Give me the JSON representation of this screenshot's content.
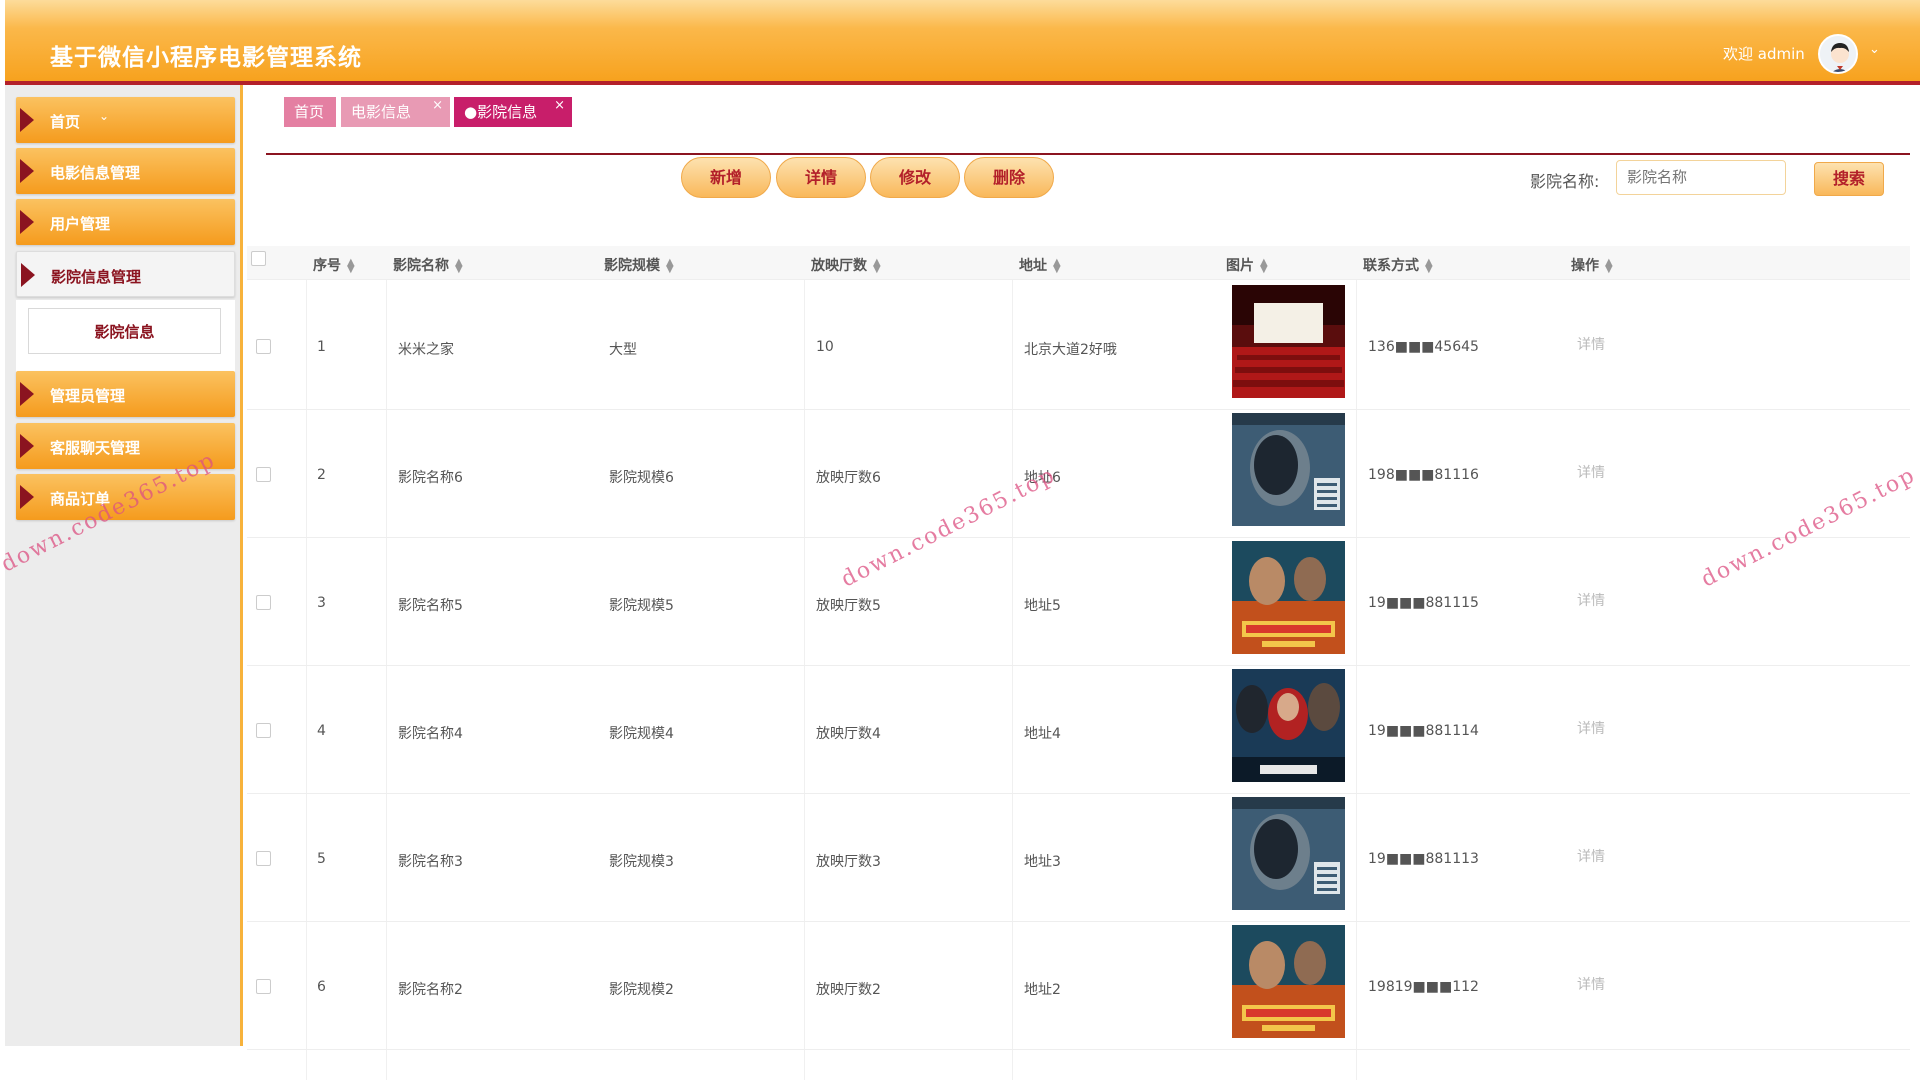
{
  "header": {
    "title": "基于微信小程序电影管理系统",
    "welcome": "欢迎 admin",
    "chevron": "⌄"
  },
  "sidebar": {
    "items": [
      {
        "label": "首页"
      },
      {
        "label": "电影信息管理"
      },
      {
        "label": "用户管理"
      },
      {
        "label": "影院信息管理"
      },
      {
        "label": "管理员管理"
      },
      {
        "label": "客服聊天管理"
      },
      {
        "label": "商品订单"
      }
    ],
    "home_chevron": "⌄",
    "submenu_label": "影院信息"
  },
  "tabs": [
    {
      "label": "首页"
    },
    {
      "label": "电影信息",
      "close": "×"
    },
    {
      "label": "●影院信息",
      "close": "×"
    }
  ],
  "toolbar": {
    "add": "新增",
    "detail": "详情",
    "edit": "修改",
    "delete": "删除",
    "search_label": "影院名称:",
    "search_placeholder": "影院名称",
    "search_button": "搜索"
  },
  "table": {
    "columns": [
      "序号",
      "影院名称",
      "影院规模",
      "放映厅数",
      "地址",
      "图片",
      "联系方式",
      "操作"
    ],
    "sort_icon": "▲▼",
    "rows": [
      {
        "no": "1",
        "name": "米米之家",
        "scale": "大型",
        "halls": "10",
        "address": "北京大道2好哦",
        "poster": "cinema",
        "phone": "136■■■45645",
        "op": "详情"
      },
      {
        "no": "2",
        "name": "影院名称6",
        "scale": "影院规模6",
        "halls": "放映厅数6",
        "address": "地址6",
        "poster": "face",
        "phone": "198■■■81116",
        "op": "详情"
      },
      {
        "no": "3",
        "name": "影院名称5",
        "scale": "影院规模5",
        "halls": "放映厅数5",
        "address": "地址5",
        "poster": "action",
        "phone": "19■■■881115",
        "op": "详情"
      },
      {
        "no": "4",
        "name": "影院名称4",
        "scale": "影院规模4",
        "halls": "放映厅数4",
        "address": "地址4",
        "poster": "hero",
        "phone": "19■■■881114",
        "op": "详情"
      },
      {
        "no": "5",
        "name": "影院名称3",
        "scale": "影院规模3",
        "halls": "放映厅数3",
        "address": "地址3",
        "poster": "face",
        "phone": "19■■■881113",
        "op": "详情"
      },
      {
        "no": "6",
        "name": "影院名称2",
        "scale": "影院规模2",
        "halls": "放映厅数2",
        "address": "地址2",
        "poster": "action",
        "phone": "19819■■■112",
        "op": "详情"
      }
    ]
  },
  "watermark": "down.code365.top",
  "colors": {
    "header_orange": "#f7a21e",
    "accent_red": "#b3202a",
    "tab_active": "#c81e6a",
    "menu_arrow": "#8b1420"
  }
}
